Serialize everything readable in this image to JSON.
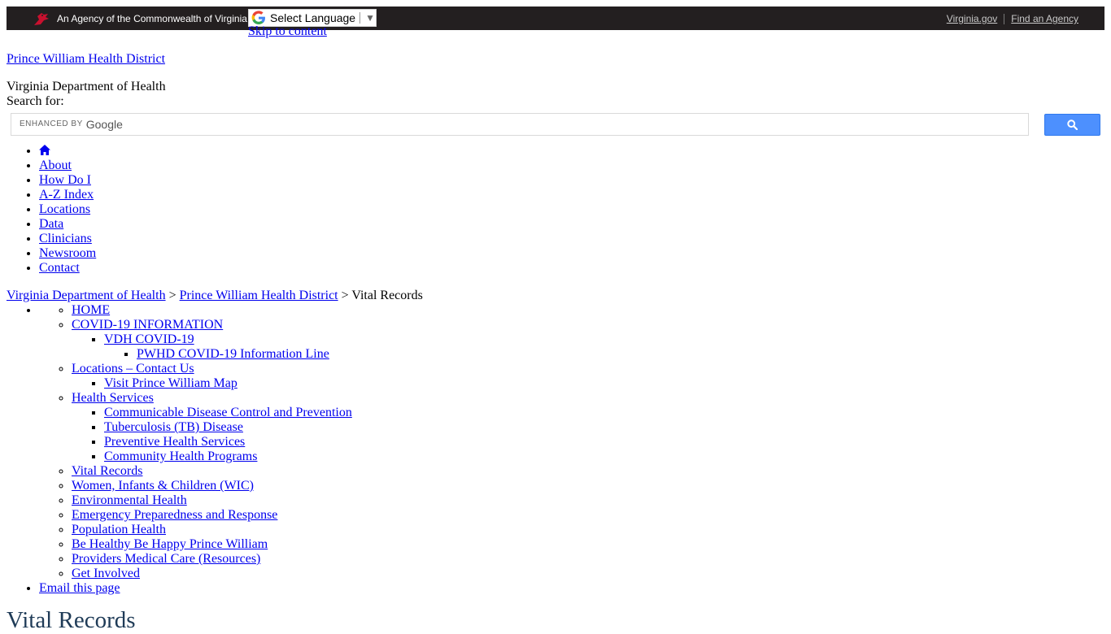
{
  "topbar": {
    "agency_text": "An Agency of the Commonwealth of Virginia",
    "links": [
      "Virginia.gov",
      "Find an Agency"
    ]
  },
  "translate": {
    "label": "Select Language",
    "caret": "▼"
  },
  "skip_link": "Skip to content",
  "site_title": "Prince William Health District",
  "logo_alt": "Virginia Department of Health",
  "search": {
    "label": "Search for:",
    "enhanced_by": "ENHANCED BY",
    "brand": "Google",
    "value": ""
  },
  "mainnav": [
    "About",
    "How Do I",
    "A-Z Index",
    "Locations",
    "Data",
    "Clinicians",
    "Newsroom",
    "Contact"
  ],
  "breadcrumb": {
    "items": [
      "Virginia Department of Health",
      "Prince William Health District"
    ],
    "separator": ">",
    "current": "Vital Records"
  },
  "sectionnav": {
    "home": "HOME",
    "covid": "COVID-19 INFORMATION",
    "vdh_covid": "VDH COVID-19",
    "pwhd_line": "PWHD COVID-19 Information Line",
    "locations": "Locations – Contact Us",
    "visit_map": "Visit Prince William Map",
    "health_services": "Health Services",
    "hs_items": [
      "Communicable Disease Control and Prevention",
      "Tuberculosis (TB) Disease",
      "Preventive Health Services",
      "Community Health Programs"
    ],
    "rest": [
      "Vital Records",
      "Women, Infants & Children (WIC)",
      "Environmental Health",
      "Emergency Preparedness and Response",
      "Population Health",
      "Be Healthy Be Happy Prince William",
      "Providers Medical Care (Resources)",
      "Get Involved"
    ],
    "email": "Email this page"
  },
  "page_title": "Vital Records",
  "colors": {
    "topbar_bg": "#231f20",
    "cardinal": "#c8102e",
    "link": "#0000ee",
    "search_button": "#4d90fe",
    "title": "#1f3b57"
  }
}
